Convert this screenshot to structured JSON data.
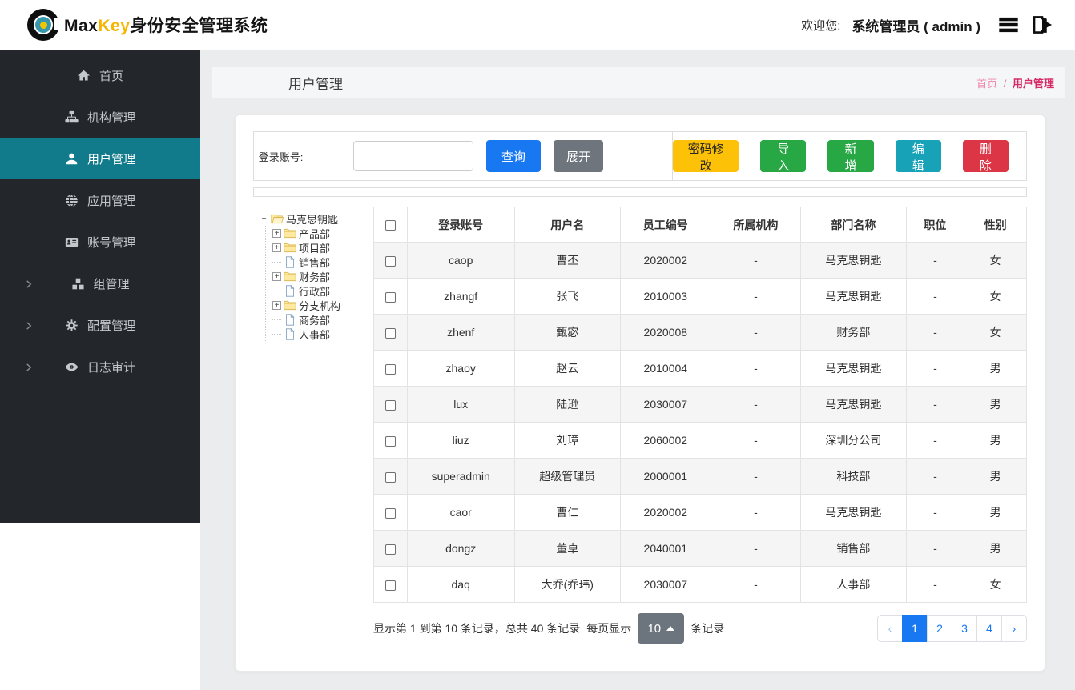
{
  "navbar": {
    "brand": {
      "part1": "Max",
      "part2": "Key",
      "part3": "身份安全管理系统"
    },
    "welcome_label": "欢迎您:",
    "username": "系统管理员 ( admin )",
    "icons": [
      "list-icon",
      "logout-icon"
    ]
  },
  "sidebar": {
    "items": [
      {
        "name": "home",
        "label": "首页",
        "icon": "home-icon",
        "active": false,
        "expandable": false
      },
      {
        "name": "org-management",
        "label": "机构管理",
        "icon": "sitemap-icon",
        "active": false,
        "expandable": false
      },
      {
        "name": "user-management",
        "label": "用户管理",
        "icon": "user-icon",
        "active": true,
        "expandable": false
      },
      {
        "name": "app-management",
        "label": "应用管理",
        "icon": "globe-icon",
        "active": false,
        "expandable": false
      },
      {
        "name": "account-management",
        "label": "账号管理",
        "icon": "id-card-icon",
        "active": false,
        "expandable": false
      },
      {
        "name": "group-management",
        "label": "组管理",
        "icon": "cubes-icon",
        "active": false,
        "expandable": true
      },
      {
        "name": "config-management",
        "label": "配置管理",
        "icon": "cogs-icon",
        "active": false,
        "expandable": true
      },
      {
        "name": "log-audit",
        "label": "日志审计",
        "icon": "eye-icon",
        "active": false,
        "expandable": true
      }
    ]
  },
  "page": {
    "title": "用户管理",
    "breadcrumb": {
      "home": "首页",
      "separator": "/",
      "current": "用户管理"
    }
  },
  "filter": {
    "label": "登录账号:",
    "input_value": "",
    "search_button": "查询",
    "expand_button": "展开",
    "actions": [
      {
        "name": "change-password",
        "label": "密码修改",
        "style": "warning"
      },
      {
        "name": "import",
        "label": "导入",
        "style": "success"
      },
      {
        "name": "add",
        "label": "新增",
        "style": "success"
      },
      {
        "name": "edit",
        "label": "编辑",
        "style": "info"
      },
      {
        "name": "delete",
        "label": "删除",
        "style": "danger"
      }
    ]
  },
  "tree": {
    "root": {
      "label": "马克思钥匙",
      "toggle": "−",
      "icon": "folder-open-icon"
    },
    "children": [
      {
        "label": "产品部",
        "type": "branch",
        "toggle": "+",
        "icon": "folder-icon"
      },
      {
        "label": "项目部",
        "type": "branch",
        "toggle": "+",
        "icon": "folder-icon"
      },
      {
        "label": "销售部",
        "type": "leaf",
        "icon": "file-icon"
      },
      {
        "label": "财务部",
        "type": "branch",
        "toggle": "+",
        "icon": "folder-icon"
      },
      {
        "label": "行政部",
        "type": "leaf",
        "icon": "file-icon"
      },
      {
        "label": "分支机构",
        "type": "branch",
        "toggle": "+",
        "icon": "folder-icon"
      },
      {
        "label": "商务部",
        "type": "leaf",
        "icon": "file-icon"
      },
      {
        "label": "人事部",
        "type": "leaf",
        "icon": "file-icon"
      }
    ]
  },
  "table": {
    "headers": [
      "登录账号",
      "用户名",
      "员工编号",
      "所属机构",
      "部门名称",
      "职位",
      "性别"
    ],
    "rows": [
      [
        "caop",
        "曹丕",
        "2020002",
        "-",
        "马克思钥匙",
        "-",
        "女"
      ],
      [
        "zhangf",
        "张飞",
        "2010003",
        "-",
        "马克思钥匙",
        "-",
        "女"
      ],
      [
        "zhenf",
        "甄宓",
        "2020008",
        "-",
        "财务部",
        "-",
        "女"
      ],
      [
        "zhaoy",
        "赵云",
        "2010004",
        "-",
        "马克思钥匙",
        "-",
        "男"
      ],
      [
        "lux",
        "陆逊",
        "2030007",
        "-",
        "马克思钥匙",
        "-",
        "男"
      ],
      [
        "liuz",
        "刘璋",
        "2060002",
        "-",
        "深圳分公司",
        "-",
        "男"
      ],
      [
        "superadmin",
        "超级管理员",
        "2000001",
        "-",
        "科技部",
        "-",
        "男"
      ],
      [
        "caor",
        "曹仁",
        "2020002",
        "-",
        "马克思钥匙",
        "-",
        "男"
      ],
      [
        "dongz",
        "董卓",
        "2040001",
        "-",
        "销售部",
        "-",
        "男"
      ],
      [
        "daq",
        "大乔(乔玮)",
        "2030007",
        "-",
        "人事部",
        "-",
        "女"
      ]
    ]
  },
  "footer": {
    "summary": "显示第 1 到第 10 条记录，总共 40 条记录",
    "per_page_prefix": "每页显示",
    "page_size": "10",
    "per_page_suffix": "条记录",
    "pagination": {
      "prev": "‹",
      "pages": [
        "1",
        "2",
        "3",
        "4"
      ],
      "next": "›",
      "active": "1"
    }
  },
  "colors": {
    "sidebar_bg": "#23272b",
    "sidebar_active": "#117a8b",
    "primary": "#1778f2",
    "secondary": "#6e757d",
    "warning": "#fdc107",
    "success": "#28a745",
    "info": "#17a2b8",
    "danger": "#dc3545",
    "breadcrumb_active": "#d62a66",
    "brand_accent": "#f7b500"
  }
}
